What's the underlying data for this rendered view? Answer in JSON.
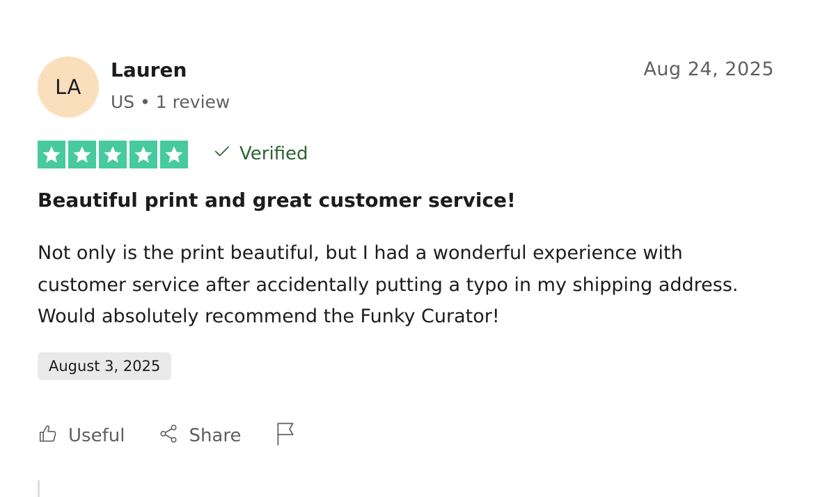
{
  "reviewer": {
    "initials": "LA",
    "name": "Lauren",
    "meta": "US • 1 review"
  },
  "review": {
    "published_date": "Aug 24, 2025",
    "rating": 5,
    "max_rating": 5,
    "verified_label": "Verified",
    "title": "Beautiful print and great customer service!",
    "body": "Not only is the print beautiful, but I had a wonderful experience with customer service after accidentally putting a typo in my shipping address. Would absolutely recommend the Funky Curator!",
    "experience_date": "August 3, 2025"
  },
  "actions": {
    "useful_label": "Useful",
    "share_label": "Share"
  },
  "colors": {
    "star_green": "#00b67a",
    "verified_green": "#2c6330",
    "avatar_bg": "#fadfbd",
    "muted_text": "#5f5f5f",
    "date_pill_bg": "#e9e9e9"
  },
  "icons": {
    "star": "star-icon",
    "verified": "checkmark-icon",
    "useful": "thumbs-up-icon",
    "share": "share-icon",
    "report": "flag-icon"
  }
}
